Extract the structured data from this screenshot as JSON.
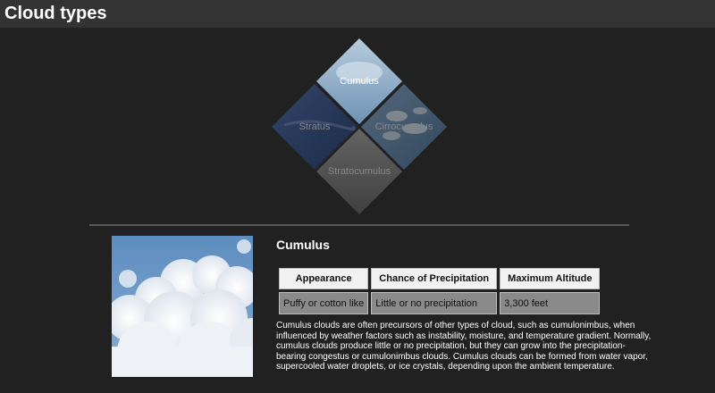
{
  "header": {
    "title": "Cloud types"
  },
  "selector": {
    "tiles": [
      {
        "label": "Cumulus",
        "selected": true
      },
      {
        "label": "Stratus",
        "selected": false
      },
      {
        "label": "Cirrocumulus",
        "selected": false
      },
      {
        "label": "Stratocumulus",
        "selected": false
      }
    ]
  },
  "detail": {
    "title": "Cumulus",
    "table": {
      "headers": [
        "Appearance",
        "Chance of Precipitation",
        "Maximum Altitude"
      ],
      "row": [
        "Puffy or cotton like",
        "Little or no precipitation",
        "3,300 feet"
      ]
    },
    "description": "Cumulus clouds are often precursors of other types of cloud, such as cumulonimbus, when influenced by weather factors such as instability, moisture, and temperature gradient. Normally, cumulus clouds produce little or no precipitation, but they can grow into the precipitation-bearing congestus or cumulonimbus clouds. Cumulus clouds can be formed from water vapor, supercooled water droplets, or ice crystals, depending upon the ambient temperature."
  },
  "colors": {
    "background": "#212121",
    "header_bar": "#333333",
    "table_header_bg": "#f1f1f1",
    "table_cell_bg": "#8a8a8a",
    "divider": "#5a5a5a"
  }
}
